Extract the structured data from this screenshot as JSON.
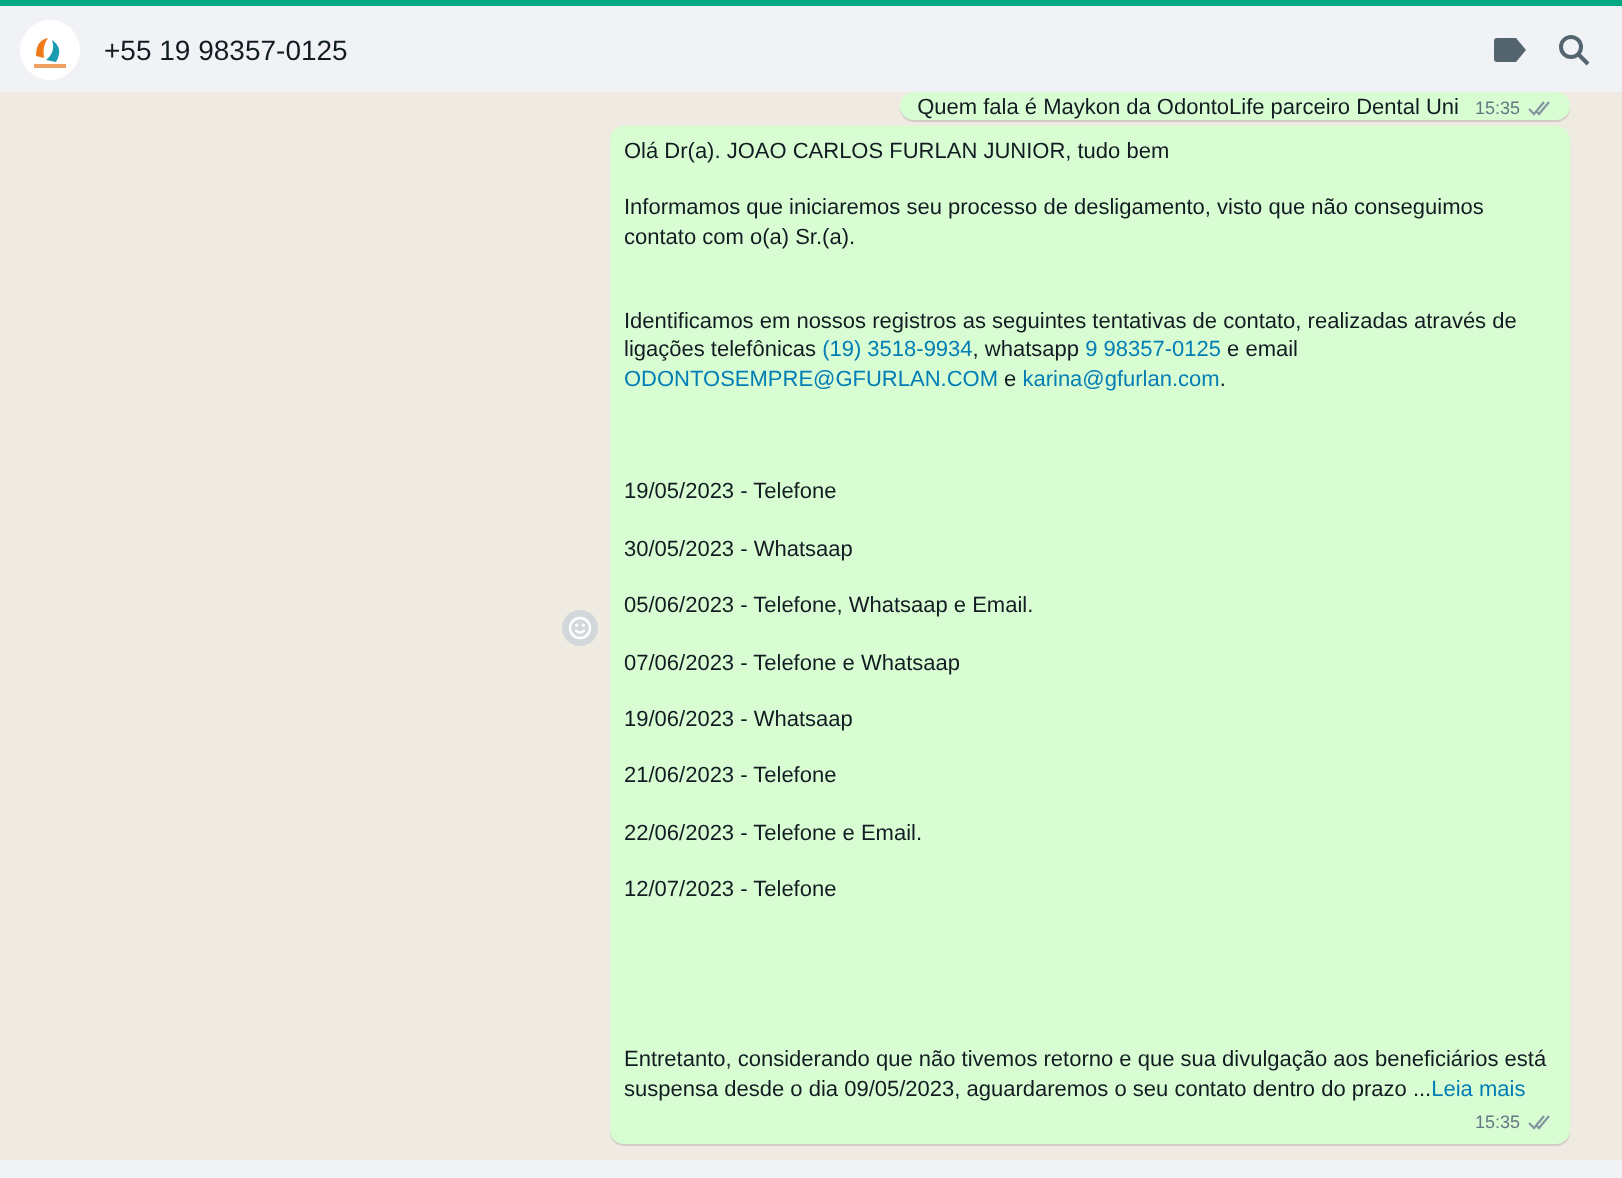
{
  "header": {
    "contact": "+55 19 98357-0125"
  },
  "messages": [
    {
      "kind": "outgoing",
      "time": "15:35",
      "read": true,
      "paragraphs": [
        [
          {
            "kind": "text",
            "text": "Quem fala é Maykon da OdontoLife parceiro Dental Uni"
          }
        ]
      ]
    },
    {
      "kind": "outgoing",
      "time": "15:35",
      "read": true,
      "paragraphs": [
        [
          {
            "kind": "text",
            "text": "Olá Dr(a). JOAO CARLOS FURLAN JUNIOR, tudo bem"
          }
        ],
        [
          {
            "kind": "text",
            "text": "Informamos que iniciaremos seu processo de desligamento, visto que não conseguimos contato com o(a) Sr.(a)."
          }
        ],
        [
          {
            "kind": "text",
            "text": "Identificamos em nossos registros as seguintes tentativas de contato, realizadas através de ligações telefônicas "
          },
          {
            "kind": "link",
            "text": "(19) 3518-9934"
          },
          {
            "kind": "text",
            "text": ", whatsapp "
          },
          {
            "kind": "link",
            "text": "9 98357-0125"
          },
          {
            "kind": "text",
            "text": " e email "
          },
          {
            "kind": "link",
            "text": "ODONTOSEMPRE@GFURLAN.COM"
          },
          {
            "kind": "text",
            "text": " e "
          },
          {
            "kind": "link",
            "text": "karina@gfurlan.com"
          },
          {
            "kind": "text",
            "text": "."
          }
        ],
        [
          {
            "kind": "text",
            "text": "19/05/2023 - Telefone"
          }
        ],
        [
          {
            "kind": "text",
            "text": "30/05/2023 - Whatsaap"
          }
        ],
        [
          {
            "kind": "text",
            "text": "05/06/2023 - Telefone, Whatsaap e Email."
          }
        ],
        [
          {
            "kind": "text",
            "text": "07/06/2023 - Telefone e Whatsaap"
          }
        ],
        [
          {
            "kind": "text",
            "text": "19/06/2023 - Whatsaap"
          }
        ],
        [
          {
            "kind": "text",
            "text": "21/06/2023 - Telefone"
          }
        ],
        [
          {
            "kind": "text",
            "text": "22/06/2023 - Telefone e Email."
          }
        ],
        [
          {
            "kind": "text",
            "text": "12/07/2023 - Telefone"
          }
        ],
        [
          {
            "kind": "text",
            "text": "Entretanto, considerando que não tivemos retorno e que sua divulgação aos beneficiários está suspensa desde o dia 09/05/2023, aguardaremos o seu contato dentro do prazo ..."
          },
          {
            "kind": "link",
            "text": "Leia mais"
          }
        ]
      ]
    }
  ]
}
